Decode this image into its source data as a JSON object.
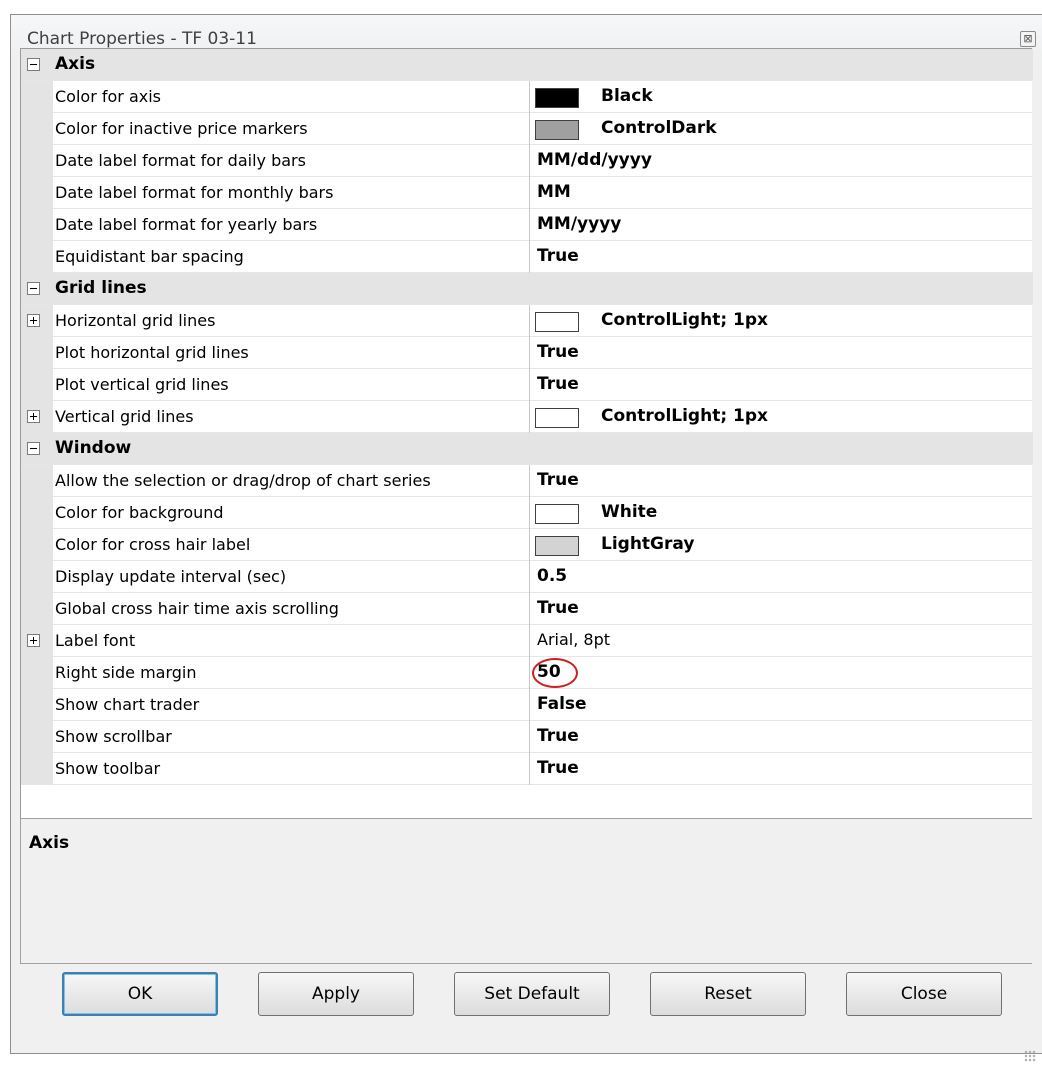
{
  "dialog": {
    "title": "Chart Properties - TF 03-11",
    "close_glyph": "⊠"
  },
  "categories": [
    {
      "label": "Axis",
      "expanded": true,
      "rows": [
        {
          "name": "Color for axis",
          "value": "Black",
          "swatch": "#000000"
        },
        {
          "name": "Color for inactive price markers",
          "value": "ControlDark",
          "swatch": "#a0a0a0"
        },
        {
          "name": "Date label format for daily bars",
          "value": "MM/dd/yyyy"
        },
        {
          "name": "Date label format for monthly bars",
          "value": "MM"
        },
        {
          "name": "Date label format for yearly bars",
          "value": "MM/yyyy"
        },
        {
          "name": "Equidistant bar spacing",
          "value": "True"
        }
      ]
    },
    {
      "label": "Grid lines",
      "expanded": true,
      "rows": [
        {
          "name": "Horizontal grid lines",
          "value": "ControlLight; 1px",
          "swatch": "#ffffff",
          "expandable": true
        },
        {
          "name": "Plot horizontal grid lines",
          "value": "True"
        },
        {
          "name": "Plot vertical grid lines",
          "value": "True"
        },
        {
          "name": "Vertical grid lines",
          "value": "ControlLight; 1px",
          "swatch": "#ffffff",
          "expandable": true
        }
      ]
    },
    {
      "label": "Window",
      "expanded": true,
      "rows": [
        {
          "name": "Allow the selection or drag/drop of chart series",
          "value": "True"
        },
        {
          "name": "Color for background",
          "value": "White",
          "swatch": "#ffffff"
        },
        {
          "name": "Color for cross hair label",
          "value": "LightGray",
          "swatch": "#d3d3d3"
        },
        {
          "name": "Display update interval (sec)",
          "value": "0.5"
        },
        {
          "name": "Global cross hair time axis scrolling",
          "value": "True"
        },
        {
          "name": "Label font",
          "value": "Arial, 8pt",
          "expandable": true,
          "plain": true
        },
        {
          "name": "Right side margin",
          "value": "50",
          "highlighted": true
        },
        {
          "name": "Show chart trader",
          "value": "False"
        },
        {
          "name": "Show scrollbar",
          "value": "True"
        },
        {
          "name": "Show toolbar",
          "value": "True"
        }
      ]
    }
  ],
  "description": {
    "title": "Axis"
  },
  "buttons": {
    "ok": "OK",
    "apply": "Apply",
    "set_default": "Set Default",
    "reset": "Reset",
    "close": "Close"
  },
  "colors": {
    "highlight_circle": "#cc1f1f",
    "default_button_border": "#3c7fb1"
  }
}
